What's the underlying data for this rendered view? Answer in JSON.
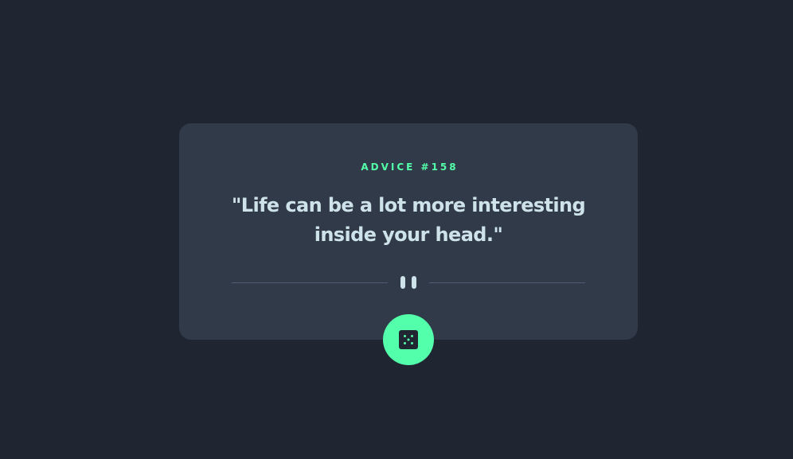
{
  "card": {
    "advice_label": "ADVICE #158",
    "quote": "\"Life can be a lot more interesting inside your head.\""
  },
  "divider": {
    "icon": "pause-icon"
  },
  "dice_button": {
    "icon": "dice-icon",
    "aria_label": "Get new advice"
  },
  "colors": {
    "background": "#1f2631",
    "card": "#313a48",
    "accent": "#53ffaa",
    "text": "#cee3e9",
    "divider": "#4f5d74"
  }
}
